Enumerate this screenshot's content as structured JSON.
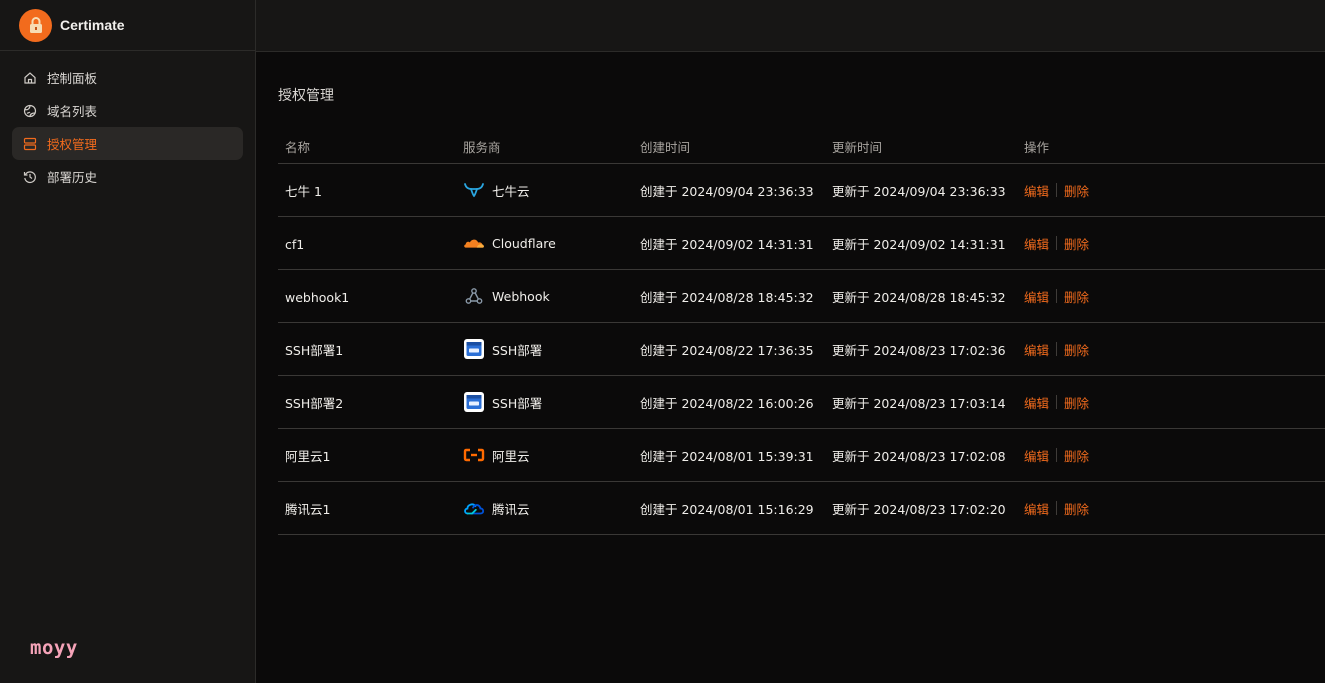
{
  "brand": {
    "name": "Certimate",
    "footer_text": "moyy"
  },
  "colors": {
    "accent": "#f26b1d",
    "sidebar_bg": "#171615",
    "page_bg": "#0b0a0a"
  },
  "nav": [
    {
      "label": "控制面板",
      "icon": "home-icon",
      "active": false
    },
    {
      "label": "域名列表",
      "icon": "globe-icon",
      "active": false
    },
    {
      "label": "授权管理",
      "icon": "server-icon",
      "active": true
    },
    {
      "label": "部署历史",
      "icon": "history-icon",
      "active": false
    }
  ],
  "page": {
    "title": "授权管理"
  },
  "table": {
    "headers": {
      "name": "名称",
      "provider": "服务商",
      "created": "创建时间",
      "updated": "更新时间",
      "actions": "操作"
    },
    "action_labels": {
      "edit": "编辑",
      "delete": "删除"
    },
    "rows": [
      {
        "name": "七牛 1",
        "provider": "七牛云",
        "provider_icon": "qiniu-icon",
        "created": "创建于 2024/09/04 23:36:33",
        "updated": "更新于 2024/09/04 23:36:33"
      },
      {
        "name": "cf1",
        "provider": "Cloudflare",
        "provider_icon": "cloudflare-icon",
        "created": "创建于 2024/09/02 14:31:31",
        "updated": "更新于 2024/09/02 14:31:31"
      },
      {
        "name": "webhook1",
        "provider": "Webhook",
        "provider_icon": "webhook-icon",
        "created": "创建于 2024/08/28 18:45:32",
        "updated": "更新于 2024/08/28 18:45:32"
      },
      {
        "name": "SSH部署1",
        "provider": "SSH部署",
        "provider_icon": "ssh-icon",
        "created": "创建于 2024/08/22 17:36:35",
        "updated": "更新于 2024/08/23 17:02:36"
      },
      {
        "name": "SSH部署2",
        "provider": "SSH部署",
        "provider_icon": "ssh-icon",
        "created": "创建于 2024/08/22 16:00:26",
        "updated": "更新于 2024/08/23 17:03:14"
      },
      {
        "name": "阿里云1",
        "provider": "阿里云",
        "provider_icon": "aliyun-icon",
        "created": "创建于 2024/08/01 15:39:31",
        "updated": "更新于 2024/08/23 17:02:08"
      },
      {
        "name": "腾讯云1",
        "provider": "腾讯云",
        "provider_icon": "tencent-cloud-icon",
        "created": "创建于 2024/08/01 15:16:29",
        "updated": "更新于 2024/08/23 17:02:20"
      }
    ]
  }
}
